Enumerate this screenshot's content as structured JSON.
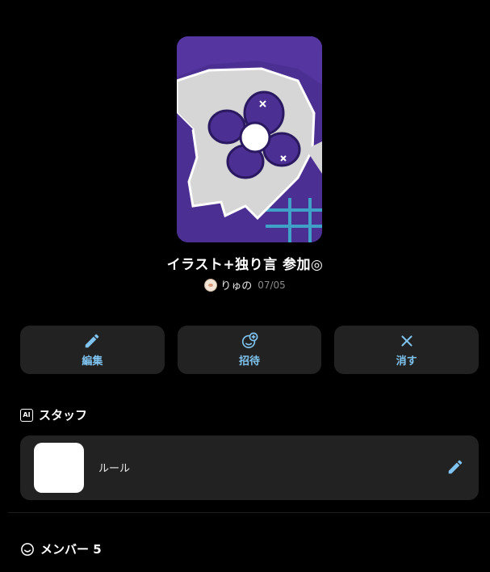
{
  "room": {
    "title": "イラスト+独り言 参加◎",
    "author_name": "りゅの",
    "date": "07/05"
  },
  "actions": [
    {
      "label": "編集",
      "icon": "pencil-icon"
    },
    {
      "label": "招待",
      "icon": "add-person-icon"
    },
    {
      "label": "消す",
      "icon": "close-icon"
    }
  ],
  "staff": {
    "badge": "AI",
    "heading": "スタッフ",
    "card_label": "ルール",
    "edit_icon": "pencil-icon"
  },
  "members": {
    "heading": "メンバー 5"
  },
  "colors": {
    "background": "#000000",
    "card": "#222222",
    "accent": "#7fc4f0"
  }
}
